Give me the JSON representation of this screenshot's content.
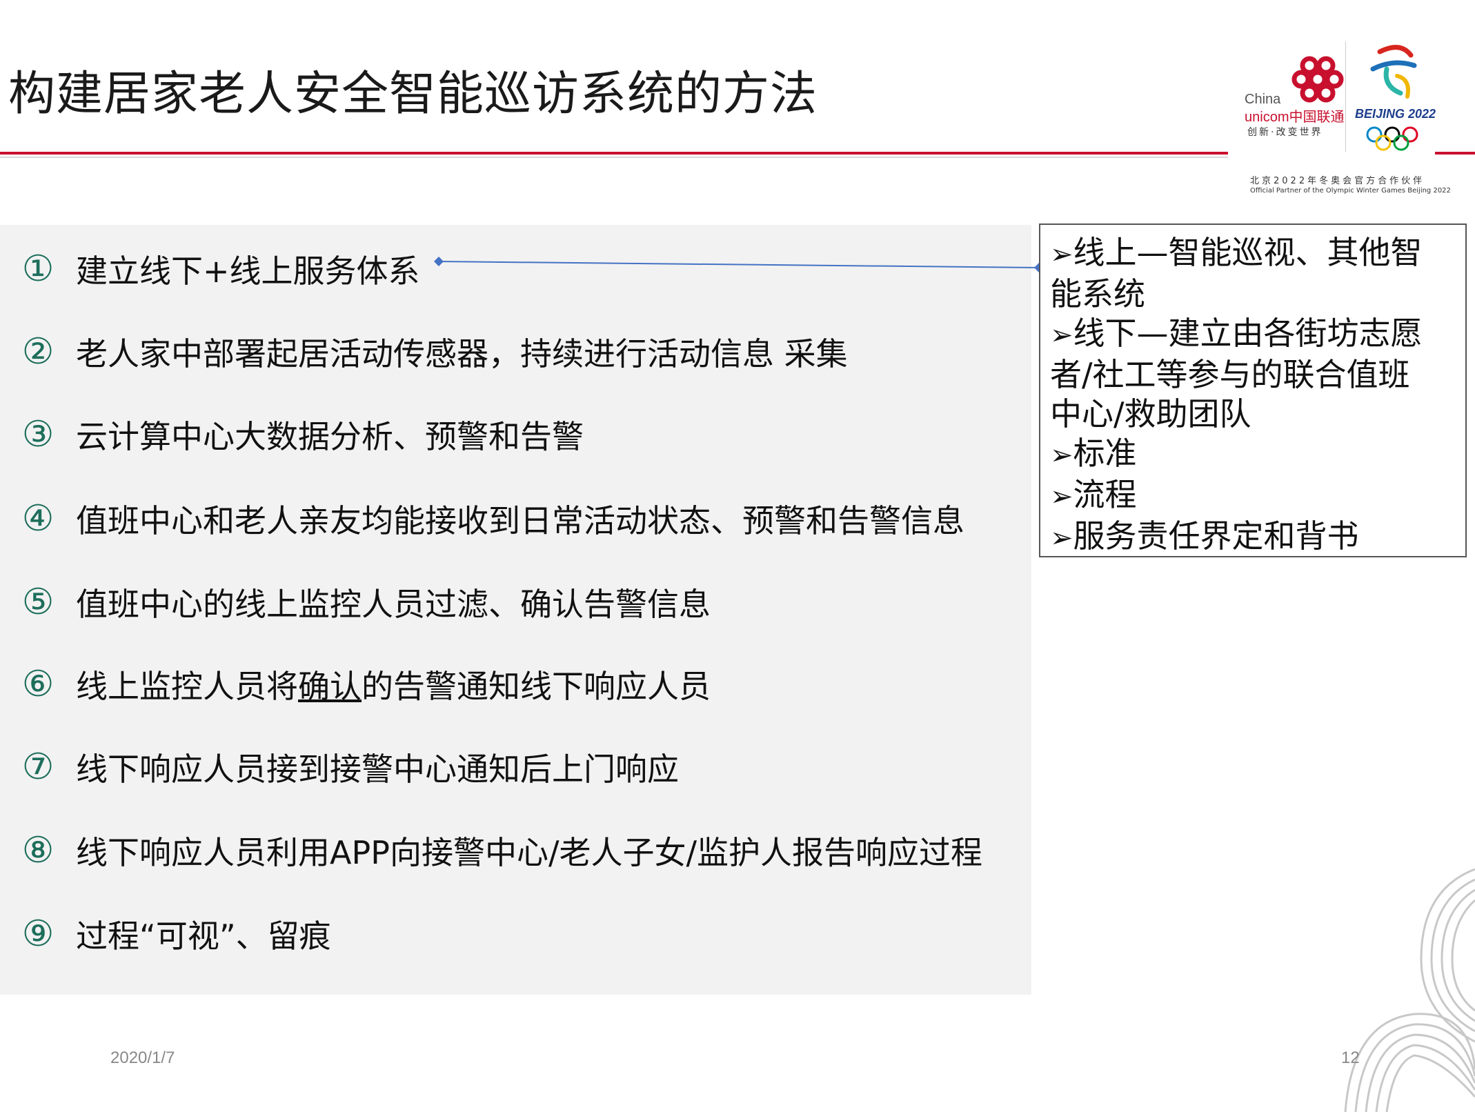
{
  "title": "构建居家老人安全智能巡访系统的方法",
  "logo": {
    "unicom_en_1": "China",
    "unicom_en_2": "unicom中国联通",
    "unicom_slogan": "创新·改变世界",
    "beijing": "BEIJING 2022",
    "partner_cn": "北京2022年冬奥会官方合作伙伴",
    "partner_en": "Official Partner of the Olympic Winter Games Beijing 2022"
  },
  "steps": [
    {
      "num": "①",
      "text": "建立线下+线上服务体系"
    },
    {
      "num": "②",
      "text": "老人家中部署起居活动传感器，持续进行活动信息 采集"
    },
    {
      "num": "③",
      "text": "云计算中心大数据分析、预警和告警"
    },
    {
      "num": "④",
      "text": "值班中心和老人亲友均能接收到日常活动状态、预警和告警信息"
    },
    {
      "num": "⑤",
      "text": "值班中心的线上监控人员过滤、确认告警信息"
    },
    {
      "num": "⑥",
      "text_before": "线上监控人员将",
      "text_underline": "确认",
      "text_after": "的告警通知线下响应人员"
    },
    {
      "num": "⑦",
      "text": "线下响应人员接到接警中心通知后上门响应"
    },
    {
      "num": "⑧",
      "text": "线下响应人员利用APP向接警中心/老人子女/监护人报告响应过程"
    },
    {
      "num": "⑨",
      "text": "过程“可视”、留痕"
    }
  ],
  "side_box": {
    "bullet": "➢",
    "lines": [
      {
        "bullet": true,
        "text": "线上—智能巡视、其他智"
      },
      {
        "bullet": false,
        "text": "能系统"
      },
      {
        "bullet": true,
        "text": "线下—建立由各街坊志愿"
      },
      {
        "bullet": false,
        "text": "者/社工等参与的联合值班"
      },
      {
        "bullet": false,
        "text": "中心/救助团队"
      },
      {
        "bullet": true,
        "text": "标准"
      },
      {
        "bullet": true,
        "text": "流程"
      },
      {
        "bullet": true,
        "text": "服务责任界定和背书"
      }
    ]
  },
  "footer": {
    "date": "2020/1/7",
    "page": "12"
  },
  "colors": {
    "accent_red": "#c8102e",
    "number_green": "#1d6e5b",
    "panel_grey": "#f2f2f2",
    "connector_blue": "#4472c4"
  }
}
